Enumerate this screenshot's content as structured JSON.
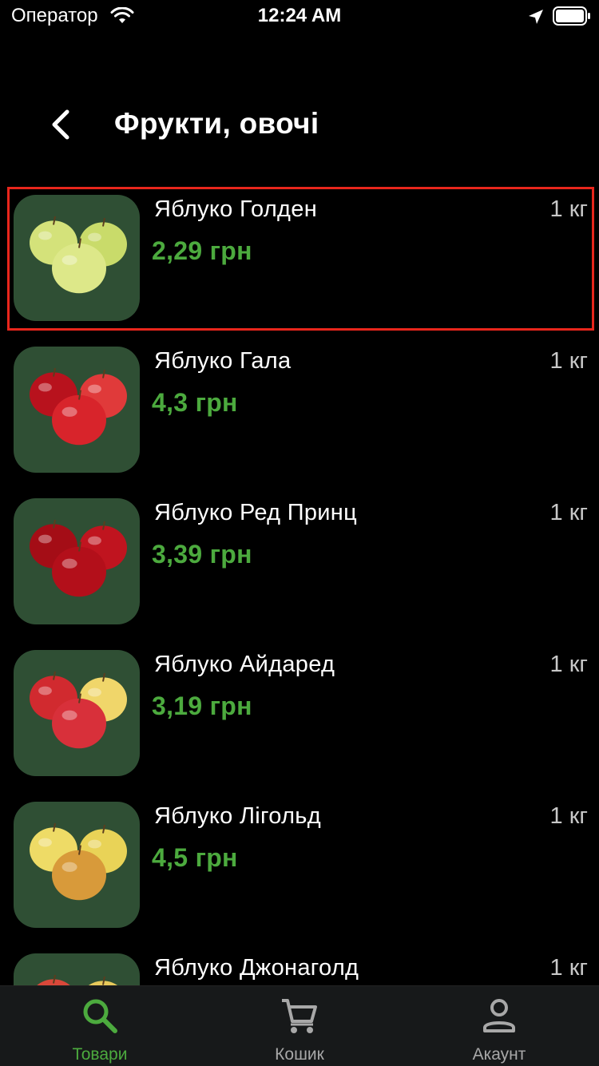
{
  "status_bar": {
    "carrier": "Оператор",
    "time": "12:24 AM"
  },
  "header": {
    "title": "Фрукти, овочі"
  },
  "products": [
    {
      "name": "Яблуко Голден",
      "price": "2,29 грн",
      "unit": "1 кг",
      "selected": true,
      "apple_colors": [
        "#d4e27a",
        "#c9db6a",
        "#dde889"
      ]
    },
    {
      "name": "Яблуко Гала",
      "price": "4,3 грн",
      "unit": "1 кг",
      "selected": false,
      "apple_colors": [
        "#b8121d",
        "#e03a3a",
        "#d8242b"
      ]
    },
    {
      "name": "Яблуко Ред Принц",
      "price": "3,39 грн",
      "unit": "1 кг",
      "selected": false,
      "apple_colors": [
        "#a40d16",
        "#c0141f",
        "#b30f1a"
      ]
    },
    {
      "name": "Яблуко Айдаред",
      "price": "3,19 грн",
      "unit": "1 кг",
      "selected": false,
      "apple_colors": [
        "#d12a2f",
        "#f0d66a",
        "#d8303a"
      ]
    },
    {
      "name": "Яблуко Лігольд",
      "price": "4,5 грн",
      "unit": "1 кг",
      "selected": false,
      "apple_colors": [
        "#eedb66",
        "#e9d357",
        "#d89a3a"
      ]
    },
    {
      "name": "Яблуко Джонаголд",
      "price": "",
      "unit": "1 кг",
      "selected": false,
      "apple_colors": [
        "#d9483a",
        "#e7c95b",
        "#d9483a"
      ]
    }
  ],
  "tab_bar": {
    "items": [
      {
        "label": "Товари",
        "icon": "search-icon",
        "active": true
      },
      {
        "label": "Кошик",
        "icon": "cart-icon",
        "active": false
      },
      {
        "label": "Акаунт",
        "icon": "person-icon",
        "active": false
      }
    ],
    "active_color": "#4caa3e",
    "inactive_color": "#a8a8a8"
  },
  "colors": {
    "price": "#4caa3e",
    "selection_border": "#e8261c",
    "thumb_bg": "#2f4f34"
  }
}
